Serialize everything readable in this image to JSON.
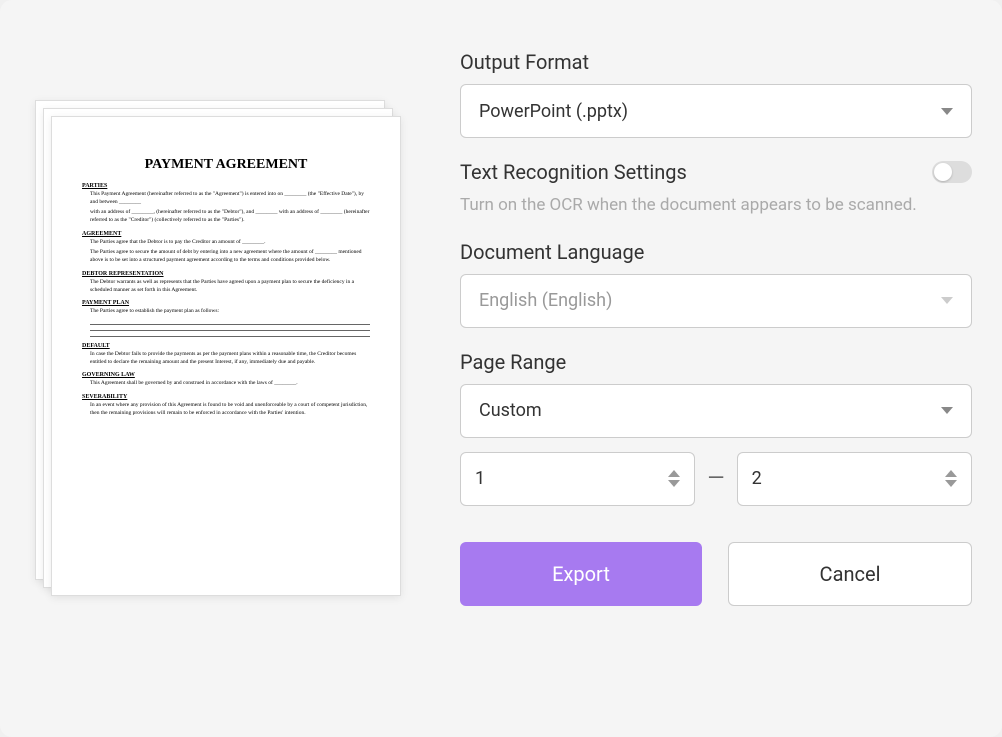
{
  "preview": {
    "title": "PAYMENT AGREEMENT",
    "sections": {
      "parties": "PARTIES",
      "parties_t1": "This Payment Agreement (hereinafter referred to as the \"Agreement\") is entered into on ________ (the \"Effective Date\"), by and between ________",
      "parties_t2": "with an address of ________, (hereinafter referred to as the \"Debtor\"), and ________ with an address of ________ (hereinafter referred to as the \"Creditor\") (collectively referred to as the \"Parties\").",
      "agreement": "AGREEMENT",
      "agreement_t1": "The Parties agree that the Debtor is to pay the Creditor an amount of ________.",
      "agreement_t2": "The Parties agree to secure the amount of debt by entering into a new agreement where the amount of ________ mentioned above is to be set into a structured payment agreement according to the terms and conditions provided below.",
      "debtor_rep": "DEBTOR REPRESENTATION",
      "debtor_rep_t": "The Debtor warrants as well as represents that the Parties have agreed upon a payment plan to secure the deficiency in a scheduled manner as set forth in this Agreement.",
      "payment_plan": "PAYMENT PLAN",
      "payment_plan_t": "The Parties agree to establish the payment plan as follows:",
      "default": "DEFAULT",
      "default_t": "In case the Debtor fails to provide the payments as per the payment plans within a reasonable time, the Creditor becomes entitled to declare the remaining amount and the present Interest, if any, immediately due and payable.",
      "governing": "GOVERNING LAW",
      "governing_t": "This Agreement shall be governed by and construed in accordance with the laws of ________.",
      "severability": "SEVERABILITY",
      "severability_t": "In an event where any provision of this Agreement is found to be void and unenforceable by a court of competent jurisdiction, then the remaining provisions will remain to be enforced in accordance with the Parties' intention."
    }
  },
  "output_format": {
    "label": "Output Format",
    "value": "PowerPoint (.pptx)"
  },
  "ocr": {
    "label": "Text Recognition Settings",
    "hint": "Turn on the OCR when the document appears to be scanned.",
    "enabled": false
  },
  "language": {
    "label": "Document Language",
    "value": "English (English)"
  },
  "page_range": {
    "label": "Page Range",
    "mode": "Custom",
    "from": "1",
    "to": "2"
  },
  "buttons": {
    "export": "Export",
    "cancel": "Cancel"
  }
}
